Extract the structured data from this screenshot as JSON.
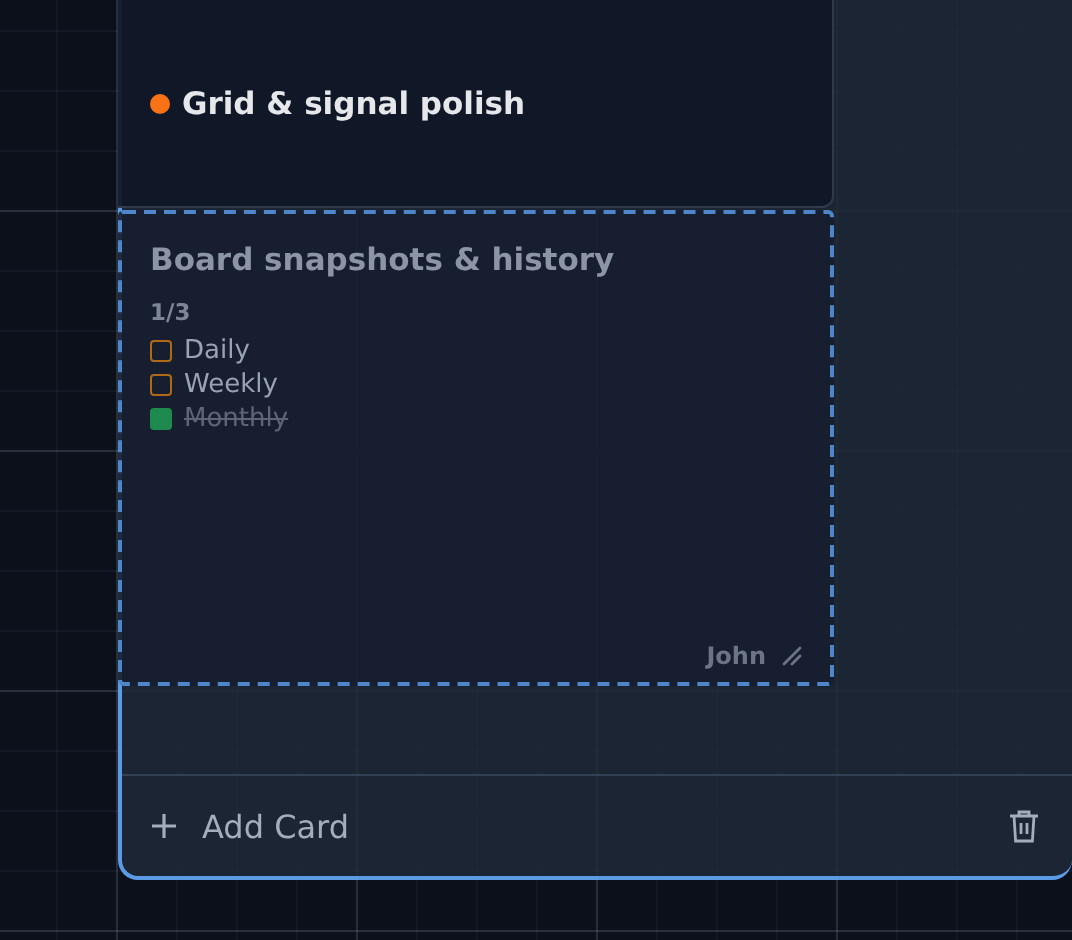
{
  "cards": [
    {
      "title": "Grid & signal polish",
      "color": "#f97316",
      "selected": false
    },
    {
      "title": "Board snapshots & history",
      "selected": true,
      "progress": "1/3",
      "checklist": [
        {
          "label": "Daily",
          "checked": false
        },
        {
          "label": "Weekly",
          "checked": false
        },
        {
          "label": "Monthly",
          "checked": true
        }
      ],
      "assignee": "John"
    }
  ],
  "footer": {
    "add_label": "Add Card"
  }
}
